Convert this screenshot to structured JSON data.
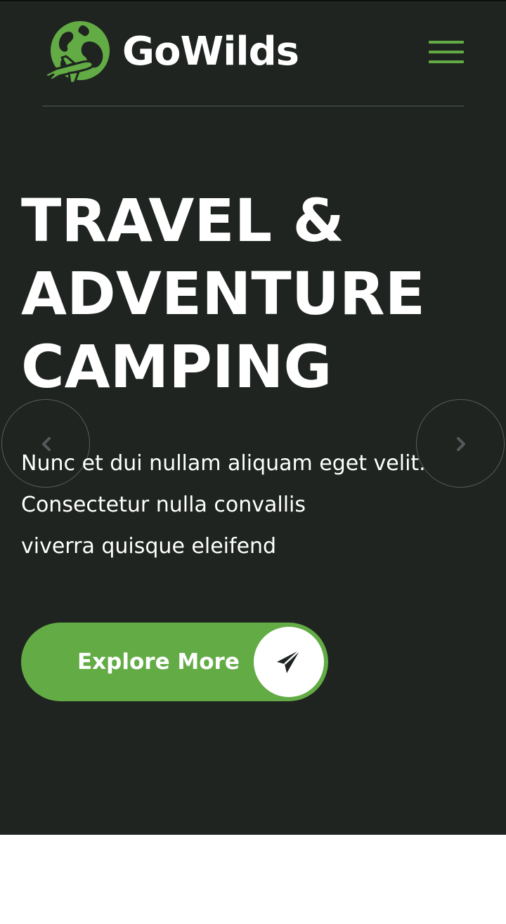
{
  "header": {
    "brand_name": "GoWilds",
    "logo_icon": "globe-airplane-icon",
    "menu_icon": "hamburger-menu-icon"
  },
  "hero": {
    "headline_lines": [
      "TRAVEL &",
      "ADVENTURE",
      "CAMPING"
    ],
    "description_lines": [
      "Nunc et dui nullam aliquam eget velit.",
      "Consectetur nulla convallis",
      "viverra quisque eleifend"
    ],
    "cta": {
      "label": "Explore More",
      "icon": "paper-plane-icon"
    },
    "slider": {
      "prev_icon": "chevron-left-icon",
      "next_icon": "chevron-right-icon"
    }
  },
  "colors": {
    "background": "#1f2420",
    "accent": "#63ab45",
    "text": "#ffffff"
  }
}
